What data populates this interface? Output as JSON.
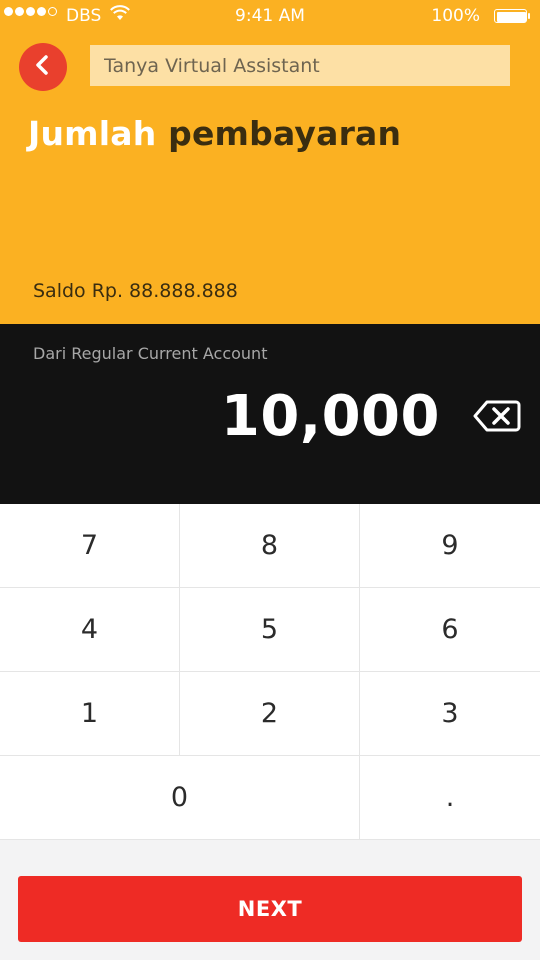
{
  "status_bar": {
    "carrier": "DBS",
    "time": "9:41 AM",
    "battery": "100%"
  },
  "header": {
    "search_placeholder": "Tanya Virtual Assistant",
    "title_part1": "Jumlah",
    "title_part2": "pembayaran",
    "balance": "Saldo Rp. 88.888.888"
  },
  "amount_panel": {
    "account_label": "Dari Regular Current Account",
    "amount": "10,000"
  },
  "keypad": {
    "keys": [
      "7",
      "8",
      "9",
      "4",
      "5",
      "6",
      "1",
      "2",
      "3",
      "0",
      "."
    ]
  },
  "next_label": "NEXT",
  "colors": {
    "header_bg": "#fbb122",
    "back_button": "#e9402d",
    "panel_bg": "#121212",
    "next_button": "#ee2b25"
  },
  "icons": {
    "back": "chevron-left-icon",
    "backspace": "backspace-icon",
    "wifi": "wifi-icon",
    "battery": "battery-icon"
  }
}
